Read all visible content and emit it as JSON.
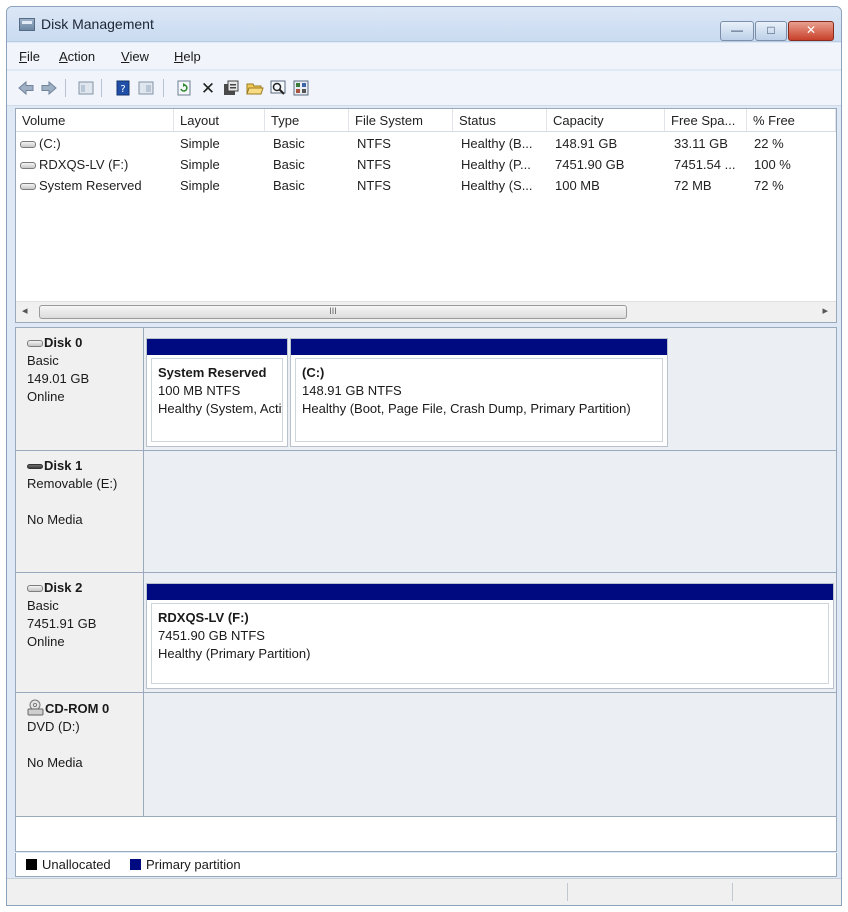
{
  "window": {
    "title": "Disk Management",
    "controls": {
      "minimize": "—",
      "maximize": "□",
      "close": "✕"
    }
  },
  "menu": [
    {
      "key": "F",
      "rest": "ile"
    },
    {
      "key": "A",
      "rest": "ction"
    },
    {
      "key": "V",
      "rest": "iew"
    },
    {
      "key": "H",
      "rest": "elp"
    }
  ],
  "toolbar": {
    "icons": [
      "back-arrow-icon",
      "forward-arrow-icon",
      "console-tree-icon",
      "help-icon",
      "properties-pane-icon",
      "refresh-icon",
      "delete-icon",
      "properties-icon",
      "open-folder-icon",
      "search-icon",
      "settings-icon"
    ],
    "accent": "#1f6fd6",
    "delete_glyph": "✕"
  },
  "volumes": {
    "columns": [
      "Volume",
      "Layout",
      "Type",
      "File System",
      "Status",
      "Capacity",
      "Free Spa...",
      "% Free"
    ],
    "rows": [
      [
        "(C:)",
        "Simple",
        "Basic",
        "NTFS",
        "Healthy (B...",
        "148.91 GB",
        "33.11 GB",
        "22 %"
      ],
      [
        "RDXQS-LV (F:)",
        "Simple",
        "Basic",
        "NTFS",
        "Healthy (P...",
        "7451.90 GB",
        "7451.54 ...",
        "100 %"
      ],
      [
        "System Reserved",
        "Simple",
        "Basic",
        "NTFS",
        "Healthy (S...",
        "100 MB",
        "72 MB",
        "72 %"
      ]
    ],
    "scroll_grip": "III",
    "scroll_left": "◂",
    "scroll_right": "▸"
  },
  "disks": [
    {
      "name": "Disk 0",
      "lines": [
        "Basic",
        "149.01 GB",
        "Online"
      ],
      "icon": "hard-disk-icon",
      "partitions": [
        {
          "label": "System Reserved",
          "size": "100 MB NTFS",
          "status": "Healthy (System, Active, Primary Partition)"
        },
        {
          "label": "(C:)",
          "size": "148.91 GB NTFS",
          "status": "Healthy (Boot, Page File, Crash Dump, Primary Partition)"
        }
      ]
    },
    {
      "name": "Disk 1",
      "lines": [
        "Removable (E:)",
        "",
        "No Media"
      ],
      "icon": "removable-disk-icon",
      "partitions": []
    },
    {
      "name": "Disk 2",
      "lines": [
        "Basic",
        "7451.91 GB",
        "Online"
      ],
      "icon": "hard-disk-icon",
      "partitions": [
        {
          "label": "RDXQS-LV  (F:)",
          "size": "7451.90 GB NTFS",
          "status": "Healthy (Primary Partition)"
        }
      ]
    },
    {
      "name": "CD-ROM 0",
      "lines": [
        "DVD (D:)",
        "",
        "No Media"
      ],
      "icon": "cd-rom-icon",
      "partitions": []
    }
  ],
  "legend": [
    {
      "label": "Unallocated",
      "color": "#000000"
    },
    {
      "label": "Primary partition",
      "color": "#000a80"
    }
  ]
}
